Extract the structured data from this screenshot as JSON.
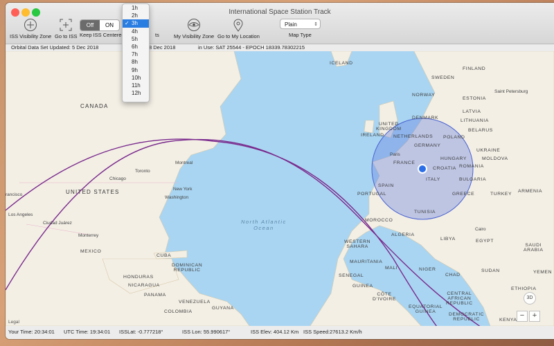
{
  "window": {
    "title": "International Space Station Track"
  },
  "toolbar": {
    "iss_visibility_zone": "ISS Visibility Zone",
    "go_to_iss": "Go to ISS",
    "keep_centered": "Keep ISS Centered",
    "toggle_off": "Off",
    "toggle_on": "ON",
    "track_hidden_suffix": "ts",
    "my_visibility_zone": "My Visibility Zone",
    "go_to_my_location": "Go to My Location",
    "map_type_value": "Plain",
    "map_type_label": "Map Type"
  },
  "dropdown": {
    "options": [
      "1h",
      "2h",
      "3h",
      "4h",
      "5h",
      "6h",
      "7h",
      "8h",
      "9h",
      "10h",
      "11h",
      "12h"
    ],
    "selected": "3h",
    "check": "✓"
  },
  "infobar": {
    "orbital_updated": "Orbital Data Set Updated:  5 Dec 2018",
    "date_partial": "8 Dec 2018",
    "in_use": "in Use:  SAT 25544  -  EPOCH 18339.78302215"
  },
  "map": {
    "labels": {
      "iceland": "ICELAND",
      "sweden": "SWEDEN",
      "finland": "FINLAND",
      "norway": "NORWAY",
      "st_petersburg": "Saint Petersburg",
      "estonia": "ESTONIA",
      "latvia": "LATVIA",
      "lithuania": "LITHUANIA",
      "denmark": "DENMARK",
      "united_kingdom": "UNITED\nKINGDOM",
      "ireland": "IRELAND",
      "netherlands": "NETHERLANDS",
      "belarus": "BELARUS",
      "poland": "POLAND",
      "germany": "GERMANY",
      "ukraine": "UKRAINE",
      "paris": "Paris",
      "france": "FRANCE",
      "hungary": "HUNGARY",
      "moldova": "MOLDOVA",
      "croatia": "CROATIA",
      "romania": "ROMANIA",
      "bulgaria": "BULGARIA",
      "italy": "ITALY",
      "spain": "SPAIN",
      "portugal": "PORTUGAL",
      "greece": "GREECE",
      "turkey": "TURKEY",
      "armenia": "ARMENIA",
      "tunisia": "TUNISIA",
      "morocco": "MOROCCO",
      "algeria": "ALGERIA",
      "libya": "LIBYA",
      "cairo": "Cairo",
      "egypt": "EGYPT",
      "western_sahara": "WESTERN\nSAHARA",
      "mauritania": "MAURITANIA",
      "mali": "MALI",
      "niger": "NIGER",
      "chad": "CHAD",
      "sudan": "SUDAN",
      "saudi_arabia": "SAUDI\nARABIA",
      "yemen": "YEMEN",
      "ethiopia": "ETHIOPIA",
      "senegal": "SENEGAL",
      "guinea": "GUINEA",
      "cote_divoire": "CÔTE\nD'IVOIRE",
      "central_african_rep": "CENTRAL\nAFRICAN\nREPUBLIC",
      "equatorial_guinea": "EQUATORIAL\nGUINEA",
      "democratic_republic": "DEMOCRATIC\nREPUBLIC",
      "kenya": "KENYA",
      "canada": "CANADA",
      "united_states": "UNITED STATES",
      "chicago": "Chicago",
      "toronto": "Toronto",
      "montreal": "Montreal",
      "new_york": "New York",
      "washington": "Washington",
      "los_angeles": "Los Angeles",
      "ciudad_juarez": "Ciudad Juárez",
      "monterrey": "Monterrey",
      "mexico": "MEXICO",
      "cuba": "CUBA",
      "dominican_republic": "DOMINICAN\nREPUBLIC",
      "honduras": "HONDURAS",
      "nicaragua": "NICARAGUA",
      "panama": "PANAMA",
      "venezuela": "VENEZUELA",
      "colombia": "COLOMBIA",
      "guyana": "GUYANA",
      "san_francisco": "rancisco",
      "north_atlantic_ocean": "North Atlantic\nOcean",
      "legal": "Legal",
      "three_d": "3D"
    }
  },
  "status": {
    "your_time": "Your Time:  20:34:01",
    "utc_time": "UTC Time: 19:34:01",
    "iss_lat": "ISSLat:  -0.777218°",
    "iss_lon": "ISS Lon:  55.990617°",
    "iss_elev": "ISS Elev: 404.12 Km",
    "iss_speed": "ISS Speed:27613.2 Km/h"
  },
  "colors": {
    "orbit_track": "#7a2a8c",
    "visibility_zone": "#5b78e0",
    "iss_marker": "#2b6ee8",
    "land": "#f3efe5",
    "water": "#a9d5f2"
  }
}
